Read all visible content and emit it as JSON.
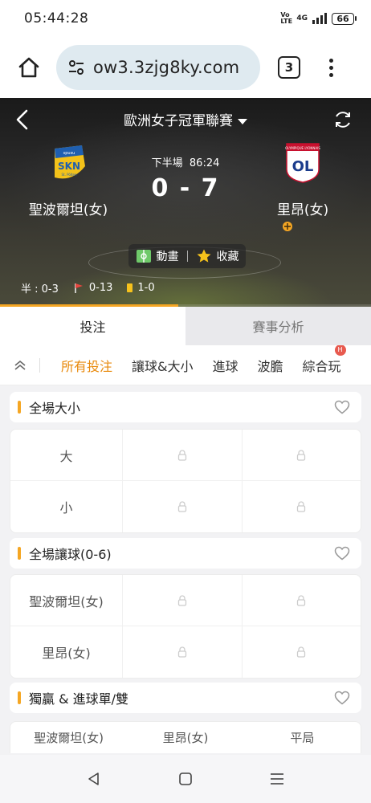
{
  "status_bar": {
    "time": "05:44:28",
    "volte_label": "Vo LTE",
    "network_label": "4G",
    "battery_level": "66"
  },
  "browser": {
    "url": "ow3.3zjg8ky.com",
    "tab_count": "3"
  },
  "match": {
    "league": "歐洲女子冠軍聯賽",
    "period": "下半場",
    "clock": "86:24",
    "score": "0 - 7",
    "home_team": "聖波爾坦(女)",
    "away_team": "里昂(女)",
    "animation_label": "動畫",
    "favorite_label": "收藏",
    "half_label": "半 : 0-3",
    "corners": "0-13",
    "yellow_cards": "1-0",
    "progress_fraction": 0.48,
    "home_logo_text": "SKN",
    "home_logo_top": "spusu",
    "home_logo_sub": "St. Pölten",
    "away_logo_text": "OL",
    "away_logo_top": "OLYMPIQUE LYONNAIS",
    "progress_color": "#f5a623"
  },
  "main_tabs": [
    {
      "label": "投注",
      "active": true
    },
    {
      "label": "賽事分析",
      "active": false
    }
  ],
  "filters": [
    {
      "label": "所有投注",
      "active": true
    },
    {
      "label": "讓球&大小",
      "active": false
    },
    {
      "label": "進球",
      "active": false
    },
    {
      "label": "波膽",
      "active": false
    },
    {
      "label": "綜合玩",
      "active": false
    }
  ],
  "hot_badge": "H",
  "markets": {
    "total": {
      "title": "全場大小",
      "rows": [
        "大",
        "小"
      ]
    },
    "handicap": {
      "title": "全場讓球(0-6)",
      "rows": [
        "聖波爾坦(女)",
        "里昂(女)"
      ]
    },
    "win_goals": {
      "title": "獨贏 & 進球單/雙",
      "outcomes": [
        "聖波爾坦(女)",
        "里昂(女)",
        "平局"
      ]
    }
  },
  "colors": {
    "accent": "#e8890c",
    "section_accent": "#f5a623"
  },
  "icons": {
    "home": "home-icon",
    "site_settings": "tune-icon",
    "back": "chevron-left-icon",
    "refresh": "refresh-icon",
    "pitch": "pitch-icon",
    "star": "star-icon",
    "heart": "heart-icon",
    "lock": "lock-icon"
  }
}
